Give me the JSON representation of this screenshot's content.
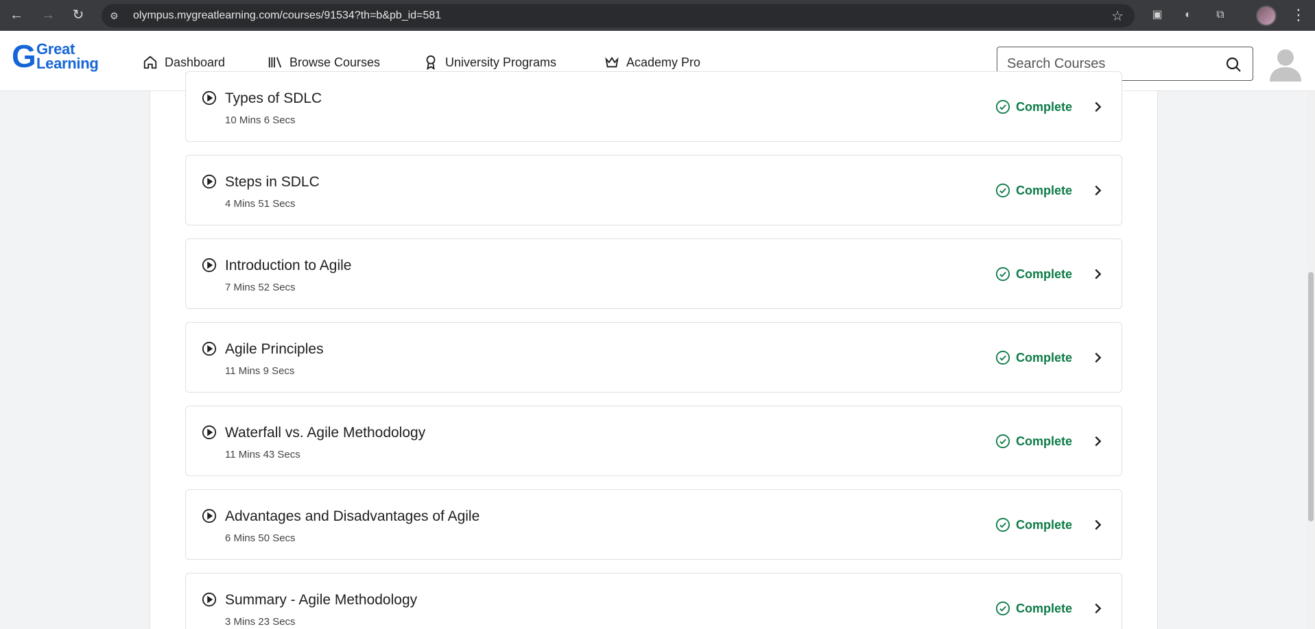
{
  "browser": {
    "url": "olympus.mygreatlearning.com/courses/91534?th=b&pb_id=581"
  },
  "header": {
    "logo_line1": "Great",
    "logo_line2": "Learning",
    "nav": [
      {
        "label": "Dashboard",
        "icon": "home-icon"
      },
      {
        "label": "Browse Courses",
        "icon": "library-icon"
      },
      {
        "label": "University Programs",
        "icon": "award-icon"
      },
      {
        "label": "Academy Pro",
        "icon": "crown-icon"
      }
    ],
    "search_placeholder": "Search Courses"
  },
  "lessons": [
    {
      "title": "Types of SDLC",
      "duration": "10 Mins 6 Secs",
      "status": "Complete"
    },
    {
      "title": "Steps in SDLC",
      "duration": "4 Mins 51 Secs",
      "status": "Complete"
    },
    {
      "title": "Introduction to Agile",
      "duration": "7 Mins 52 Secs",
      "status": "Complete"
    },
    {
      "title": "Agile Principles",
      "duration": "11 Mins 9 Secs",
      "status": "Complete"
    },
    {
      "title": "Waterfall vs. Agile Methodology",
      "duration": "11 Mins 43 Secs",
      "status": "Complete"
    },
    {
      "title": "Advantages and Disadvantages of Agile",
      "duration": "6 Mins 50 Secs",
      "status": "Complete"
    },
    {
      "title": "Summary - Agile Methodology",
      "duration": "3 Mins 23 Secs",
      "status": "Complete"
    }
  ],
  "colors": {
    "brand": "#1565d8",
    "complete": "#0b7a45"
  }
}
